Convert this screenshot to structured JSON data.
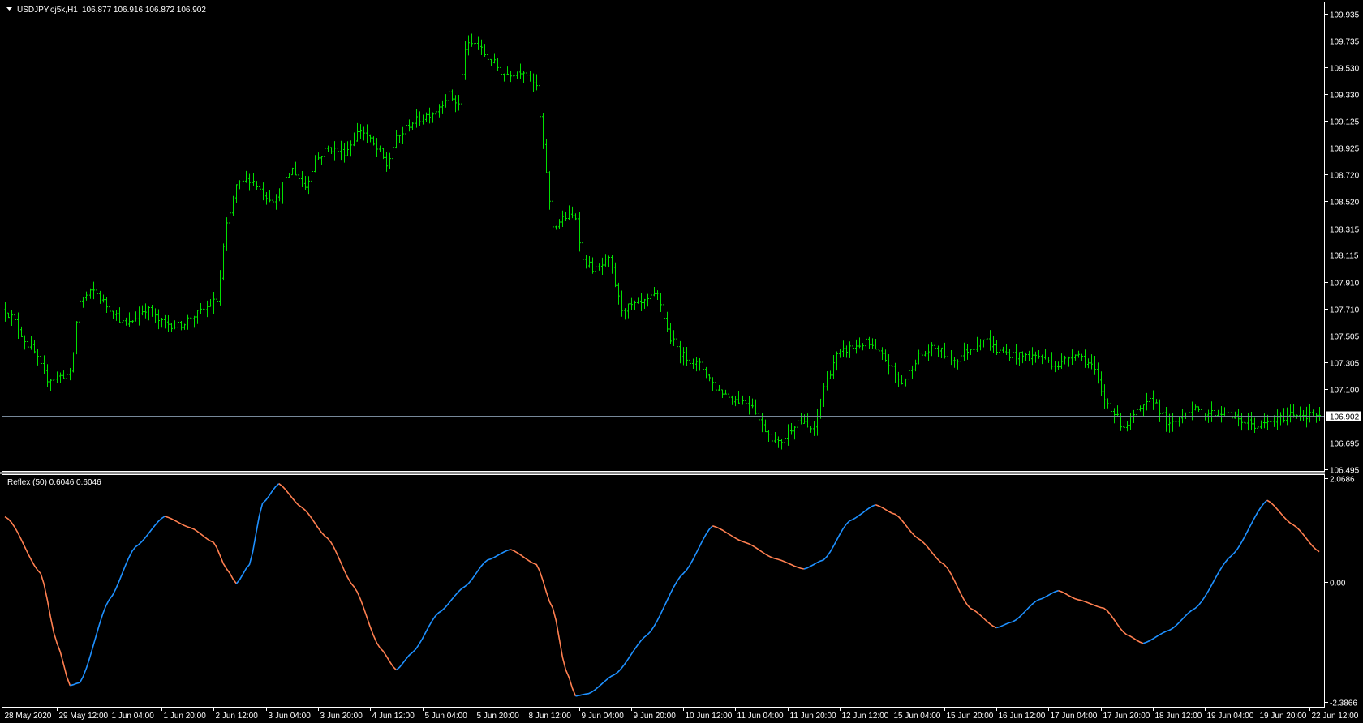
{
  "header": {
    "symbol_label": "USDJPY.oj5k,H1",
    "ohlc": "106.877 106.916 106.872 106.902"
  },
  "indicator": {
    "label": "Reflex (50) 0.6046 0.6046"
  },
  "colors": {
    "background": "#000000",
    "bars": "#00e000",
    "rising": "#1e90ff",
    "falling": "#ff7f50",
    "price_line": "#778899",
    "frame": "#ffffff"
  },
  "chart_data": [
    {
      "type": "ohlc",
      "title": "USDJPY.oj5k,H1",
      "bar_count": 404,
      "ylim": [
        106.495,
        109.935
      ],
      "current_price": 106.902,
      "current_price_label": "106.902",
      "y_ticks": [
        "109.935",
        "109.735",
        "109.530",
        "109.330",
        "109.125",
        "108.925",
        "108.720",
        "108.520",
        "108.315",
        "108.115",
        "107.910",
        "107.710",
        "107.505",
        "107.305",
        "107.100",
        "106.695",
        "106.495"
      ],
      "x_ticks": [
        "28 May 2020",
        "29 May 12:00",
        "1 Jun 04:00",
        "1 Jun 20:00",
        "2 Jun 12:00",
        "3 Jun 04:00",
        "3 Jun 20:00",
        "4 Jun 12:00",
        "5 Jun 04:00",
        "5 Jun 20:00",
        "8 Jun 12:00",
        "9 Jun 04:00",
        "9 Jun 20:00",
        "10 Jun 12:00",
        "11 Jun 04:00",
        "11 Jun 20:00",
        "12 Jun 12:00",
        "15 Jun 04:00",
        "15 Jun 20:00",
        "16 Jun 12:00",
        "17 Jun 04:00",
        "17 Jun 20:00",
        "18 Jun 12:00",
        "19 Jun 04:00",
        "19 Jun 20:00",
        "22 Jun 12:00"
      ],
      "x_tick_every_bars": 16,
      "close_path": [
        [
          0,
          107.7
        ],
        [
          1,
          107.67
        ],
        [
          8,
          107.41
        ],
        [
          13,
          107.18
        ],
        [
          20,
          107.21
        ],
        [
          23,
          107.77
        ],
        [
          27,
          107.84
        ],
        [
          32,
          107.71
        ],
        [
          37,
          107.58
        ],
        [
          43,
          107.71
        ],
        [
          48,
          107.6
        ],
        [
          53,
          107.58
        ],
        [
          59,
          107.67
        ],
        [
          65,
          107.77
        ],
        [
          68,
          108.33
        ],
        [
          71,
          108.63
        ],
        [
          75,
          108.69
        ],
        [
          80,
          108.56
        ],
        [
          83,
          108.53
        ],
        [
          88,
          108.76
        ],
        [
          92,
          108.63
        ],
        [
          95,
          108.83
        ],
        [
          99,
          108.92
        ],
        [
          104,
          108.89
        ],
        [
          109,
          109.06
        ],
        [
          115,
          108.89
        ],
        [
          117,
          108.79
        ],
        [
          120,
          108.99
        ],
        [
          125,
          109.12
        ],
        [
          131,
          109.19
        ],
        [
          136,
          109.32
        ],
        [
          139,
          109.25
        ],
        [
          141,
          109.68
        ],
        [
          144,
          109.71
        ],
        [
          149,
          109.58
        ],
        [
          153,
          109.48
        ],
        [
          159,
          109.51
        ],
        [
          163,
          109.38
        ],
        [
          165,
          108.92
        ],
        [
          168,
          108.33
        ],
        [
          172,
          108.4
        ],
        [
          175,
          108.4
        ],
        [
          177,
          108.07
        ],
        [
          181,
          108.0
        ],
        [
          185,
          108.07
        ],
        [
          189,
          107.71
        ],
        [
          195,
          107.74
        ],
        [
          200,
          107.81
        ],
        [
          204,
          107.48
        ],
        [
          208,
          107.35
        ],
        [
          213,
          107.28
        ],
        [
          219,
          107.09
        ],
        [
          224,
          107.02
        ],
        [
          229,
          106.99
        ],
        [
          232,
          106.82
        ],
        [
          237,
          106.69
        ],
        [
          243,
          106.86
        ],
        [
          248,
          106.79
        ],
        [
          251,
          107.12
        ],
        [
          255,
          107.35
        ],
        [
          259,
          107.41
        ],
        [
          264,
          107.45
        ],
        [
          269,
          107.35
        ],
        [
          275,
          107.15
        ],
        [
          280,
          107.35
        ],
        [
          285,
          107.41
        ],
        [
          291,
          107.32
        ],
        [
          296,
          107.41
        ],
        [
          300,
          107.48
        ],
        [
          305,
          107.38
        ],
        [
          311,
          107.35
        ],
        [
          317,
          107.35
        ],
        [
          323,
          107.28
        ],
        [
          328,
          107.38
        ],
        [
          333,
          107.28
        ],
        [
          337,
          107.02
        ],
        [
          343,
          106.82
        ],
        [
          347,
          106.92
        ],
        [
          352,
          107.02
        ],
        [
          357,
          106.82
        ],
        [
          363,
          106.95
        ],
        [
          368,
          106.92
        ],
        [
          373,
          106.92
        ],
        [
          379,
          106.86
        ],
        [
          384,
          106.82
        ],
        [
          389,
          106.86
        ],
        [
          395,
          106.92
        ],
        [
          400,
          106.9
        ],
        [
          403,
          106.902
        ]
      ]
    },
    {
      "type": "line",
      "title": "Reflex (50)",
      "ylim": [
        -2.3866,
        2.0686
      ],
      "y_ticks": [
        "2.0686",
        "0.00",
        "-2.3866"
      ],
      "last_value": 0.6046,
      "points": [
        [
          0,
          1.3
        ],
        [
          1,
          1.26
        ],
        [
          11,
          0.17
        ],
        [
          16,
          -1.22
        ],
        [
          20,
          -2.06
        ],
        [
          23,
          -2.0
        ],
        [
          32,
          -0.35
        ],
        [
          40,
          0.7
        ],
        [
          49,
          1.31
        ],
        [
          57,
          1.08
        ],
        [
          64,
          0.79
        ],
        [
          68,
          0.26
        ],
        [
          71,
          -0.03
        ],
        [
          75,
          0.35
        ],
        [
          79,
          1.57
        ],
        [
          84,
          1.96
        ],
        [
          91,
          1.49
        ],
        [
          99,
          0.87
        ],
        [
          107,
          -0.09
        ],
        [
          115,
          -1.31
        ],
        [
          120,
          -1.75
        ],
        [
          125,
          -1.4
        ],
        [
          133,
          -0.61
        ],
        [
          141,
          -0.09
        ],
        [
          148,
          0.44
        ],
        [
          155,
          0.65
        ],
        [
          163,
          0.35
        ],
        [
          168,
          -0.52
        ],
        [
          172,
          -1.75
        ],
        [
          175,
          -2.27
        ],
        [
          179,
          -2.22
        ],
        [
          187,
          -1.84
        ],
        [
          197,
          -1.05
        ],
        [
          208,
          0.17
        ],
        [
          217,
          1.12
        ],
        [
          227,
          0.79
        ],
        [
          236,
          0.47
        ],
        [
          245,
          0.26
        ],
        [
          251,
          0.44
        ],
        [
          259,
          1.22
        ],
        [
          267,
          1.54
        ],
        [
          273,
          1.35
        ],
        [
          280,
          0.87
        ],
        [
          288,
          0.35
        ],
        [
          296,
          -0.52
        ],
        [
          304,
          -0.91
        ],
        [
          309,
          -0.79
        ],
        [
          317,
          -0.35
        ],
        [
          323,
          -0.17
        ],
        [
          329,
          -0.35
        ],
        [
          337,
          -0.52
        ],
        [
          344,
          -1.05
        ],
        [
          349,
          -1.22
        ],
        [
          357,
          -0.96
        ],
        [
          365,
          -0.52
        ],
        [
          376,
          0.52
        ],
        [
          387,
          1.63
        ],
        [
          395,
          1.14
        ],
        [
          403,
          0.6046
        ]
      ]
    }
  ]
}
